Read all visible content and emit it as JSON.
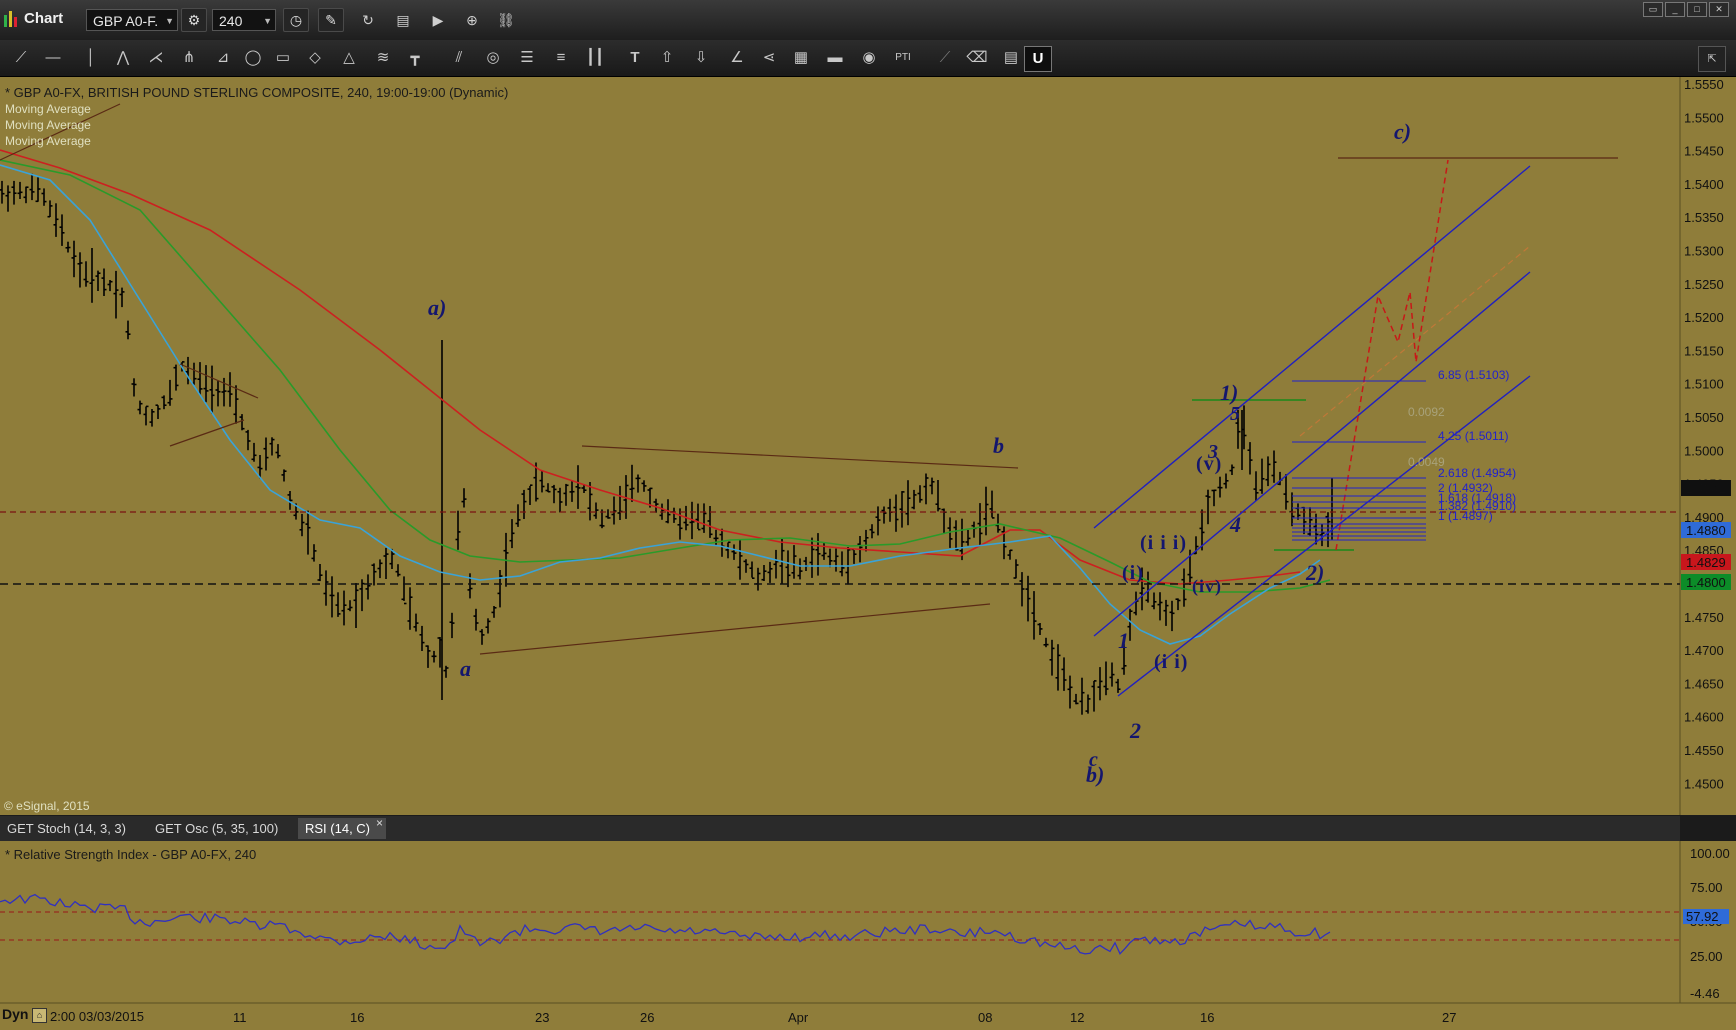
{
  "window": {
    "title": "Chart"
  },
  "toolbar": {
    "symbol": "GBP A0-F.",
    "interval": "240"
  },
  "chart": {
    "description": "* GBP A0-FX, BRITISH POUND STERLING COMPOSITE, 240, 19:00-19:00 (Dynamic)",
    "studies": [
      "Moving Average",
      "Moving Average",
      "Moving Average"
    ],
    "copyright": "© eSignal, 2015",
    "price_ticks": [
      "1.5550",
      "1.5500",
      "1.5450",
      "1.5400",
      "1.5350",
      "1.5300",
      "1.5250",
      "1.5200",
      "1.5150",
      "1.5100",
      "1.5050",
      "1.5000",
      "1.4950",
      "1.4900",
      "1.4850",
      "1.4800",
      "1.4750",
      "1.4700",
      "1.4650",
      "1.4600",
      "1.4550",
      "1.4500"
    ],
    "price_markers": [
      {
        "label": "1.4941",
        "bg": "#101010",
        "fg": "#ffffff"
      },
      {
        "label": "1.4880",
        "bg": "#2f6bd8",
        "fg": "#ffffff"
      },
      {
        "label": "1.4829",
        "bg": "#c8161c",
        "fg": "#ffffff"
      },
      {
        "label": "1.4800",
        "bg": "#0c8c28",
        "fg": "#ffffff"
      }
    ],
    "wave_labels": {
      "a_paren": "a)",
      "a": "a",
      "b": "b",
      "c": "c",
      "b_paren": "b)",
      "c_paren": "c)",
      "one": "1",
      "two": "2",
      "three": "3",
      "four": "4",
      "five": "5",
      "one_paren": "1)",
      "two_paren": "2)",
      "i": "(i)",
      "ii": "(i i)",
      "iii": "(i i i)",
      "iv": "(iv)",
      "v": "(v)"
    },
    "fib_levels": [
      "6.85 (1.5103)",
      "4.25 (1.5011)",
      "2.618 (1.4954)",
      "2 (1.4932)",
      "1.618 (1.4918)",
      "1.382 (1.4910)",
      "1 (1.4897)"
    ],
    "fib_other": [
      "0.0092",
      "0.0049"
    ],
    "colors": {
      "background": "#8f7d3a",
      "bars": "#000000",
      "ma_fast": "#3aa3d8",
      "ma_mid": "#2a9a2a",
      "ma_slow": "#cc2020",
      "channel": "#2020c0"
    }
  },
  "panels": {
    "tabs": [
      "GET Stoch (14, 3, 3)",
      "GET Osc (5, 35, 100)",
      "RSI (14, C)"
    ],
    "rsi_title": "* Relative Strength Index - GBP A0-FX, 240",
    "rsi_ticks": [
      "100.00",
      "75.00",
      "50.00",
      "25.00",
      "-4.46"
    ],
    "rsi_value": "57.92"
  },
  "time_axis": {
    "start": "Dyn",
    "start_date": "2:00 03/03/2015",
    "labels": [
      "11",
      "16",
      "23",
      "26",
      "Apr",
      "08",
      "12",
      "16",
      "27"
    ]
  }
}
